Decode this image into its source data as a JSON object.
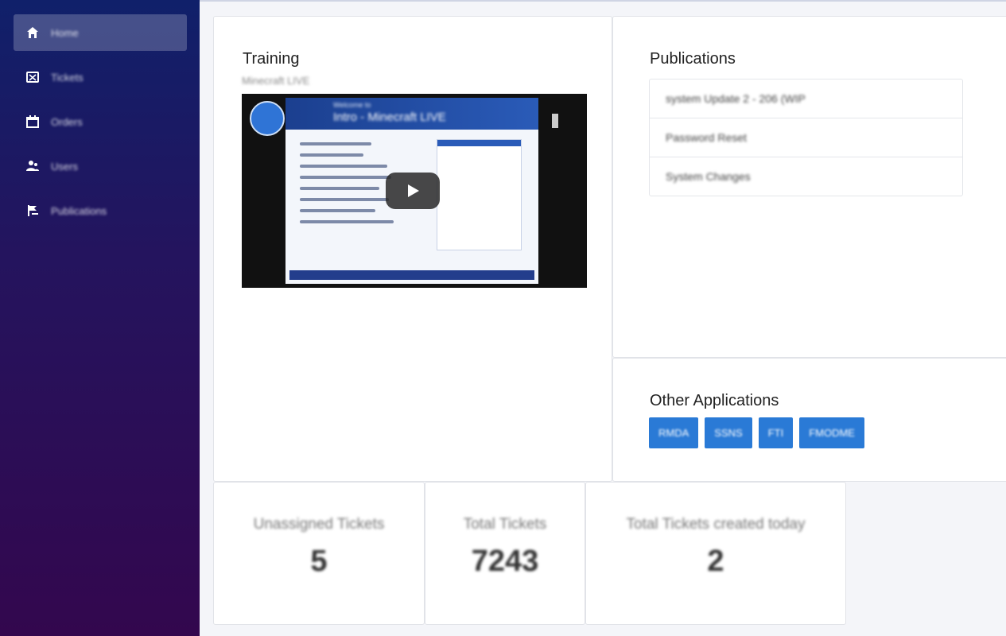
{
  "sidebar": {
    "items": [
      {
        "label": "Home",
        "icon": "home-icon",
        "active": true
      },
      {
        "label": "Tickets",
        "icon": "ticket-icon",
        "active": false
      },
      {
        "label": "Orders",
        "icon": "calendar-icon",
        "active": false
      },
      {
        "label": "Users",
        "icon": "users-icon",
        "active": false
      },
      {
        "label": "Publications",
        "icon": "flag-icon",
        "active": false
      }
    ]
  },
  "training": {
    "title": "Training",
    "subtitle": "Minecraft LIVE",
    "video": {
      "slide_title": "Intro - Minecraft LIVE",
      "slide_small": "Welcome to"
    }
  },
  "publications": {
    "title": "Publications",
    "items": [
      "system Update 2 - 206 (WIP",
      "Password Reset",
      "System Changes"
    ]
  },
  "other_applications": {
    "title": "Other Applications",
    "buttons": [
      "RMDA",
      "SSNS",
      "FTI",
      "FMODME"
    ]
  },
  "stats": [
    {
      "label": "Unassigned Tickets",
      "value": "5"
    },
    {
      "label": "Total Tickets",
      "value": "7243"
    },
    {
      "label": "Total Tickets created today",
      "value": "2"
    }
  ],
  "colors": {
    "sidebar_top": "#10206a",
    "sidebar_bottom": "#33074e",
    "app_button": "#2a7ad6"
  }
}
